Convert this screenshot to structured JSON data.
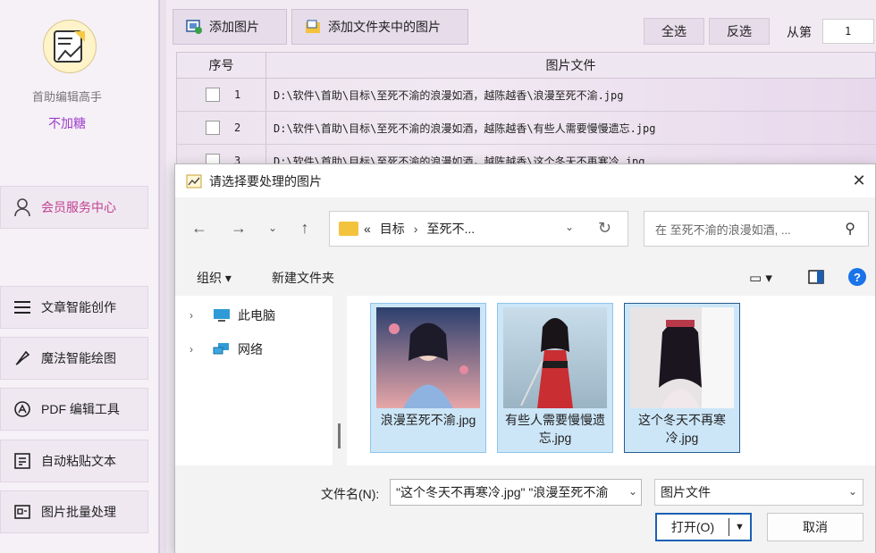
{
  "sidebar": {
    "app_name": "首助编辑高手",
    "slogan": "不加糖",
    "member_center": "会员服务中心",
    "menu": [
      {
        "label": "文章智能创作",
        "icon": "list-icon"
      },
      {
        "label": "魔法智能绘图",
        "icon": "brush-icon"
      },
      {
        "label": "PDF 编辑工具",
        "icon": "pdf-icon"
      },
      {
        "label": "自动粘贴文本",
        "icon": "paste-icon"
      },
      {
        "label": "图片批量处理",
        "icon": "image-icon"
      }
    ]
  },
  "toolbar": {
    "add_image": "添加图片",
    "add_folder_images": "添加文件夹中的图片",
    "select_all": "全选",
    "invert_select": "反选",
    "from_label": "从第",
    "from_value": "1"
  },
  "table": {
    "headers": {
      "no": "序号",
      "file": "图片文件"
    },
    "rows": [
      {
        "no": "1",
        "file": "D:\\软件\\首助\\目标\\至死不渝的浪漫如酒，越陈越香\\浪漫至死不渝.jpg"
      },
      {
        "no": "2",
        "file": "D:\\软件\\首助\\目标\\至死不渝的浪漫如酒，越陈越香\\有些人需要慢慢遗忘.jpg"
      },
      {
        "no": "3",
        "file": "D:\\软件\\首助\\目标\\至死不渝的浪漫如酒，越陈越香\\这个冬天不再寒冷.jpg"
      }
    ]
  },
  "dialog": {
    "title": "请选择要处理的图片",
    "address": {
      "prefix": "«",
      "crumb1": "目标",
      "crumb2": "至死不..."
    },
    "search_placeholder": "在 至死不渝的浪漫如酒, ...",
    "organize": "组织 ▾",
    "new_folder": "新建文件夹",
    "tree": [
      {
        "label": "此电脑",
        "icon": "computer-icon"
      },
      {
        "label": "网络",
        "icon": "network-icon"
      }
    ],
    "files": [
      {
        "name": "浪漫至死不渝.jpg",
        "icon": "image-thumbnail-icon"
      },
      {
        "name": "有些人需要慢慢遗忘.jpg",
        "icon": "image-thumbnail-icon"
      },
      {
        "name": "这个冬天不再寒冷.jpg",
        "icon": "image-thumbnail-icon"
      }
    ],
    "filename_label": "文件名(N):",
    "filename_value": "\"这个冬天不再寒冷.jpg\" \"浪漫至死不渝",
    "filetype": "图片文件",
    "open_label": "打开(O)",
    "cancel_label": "取消"
  },
  "colors": {
    "accent": "#1a5fb4",
    "slogan": "#9c3fc9",
    "member": "#c2418f",
    "selection": "#cce6f8"
  }
}
